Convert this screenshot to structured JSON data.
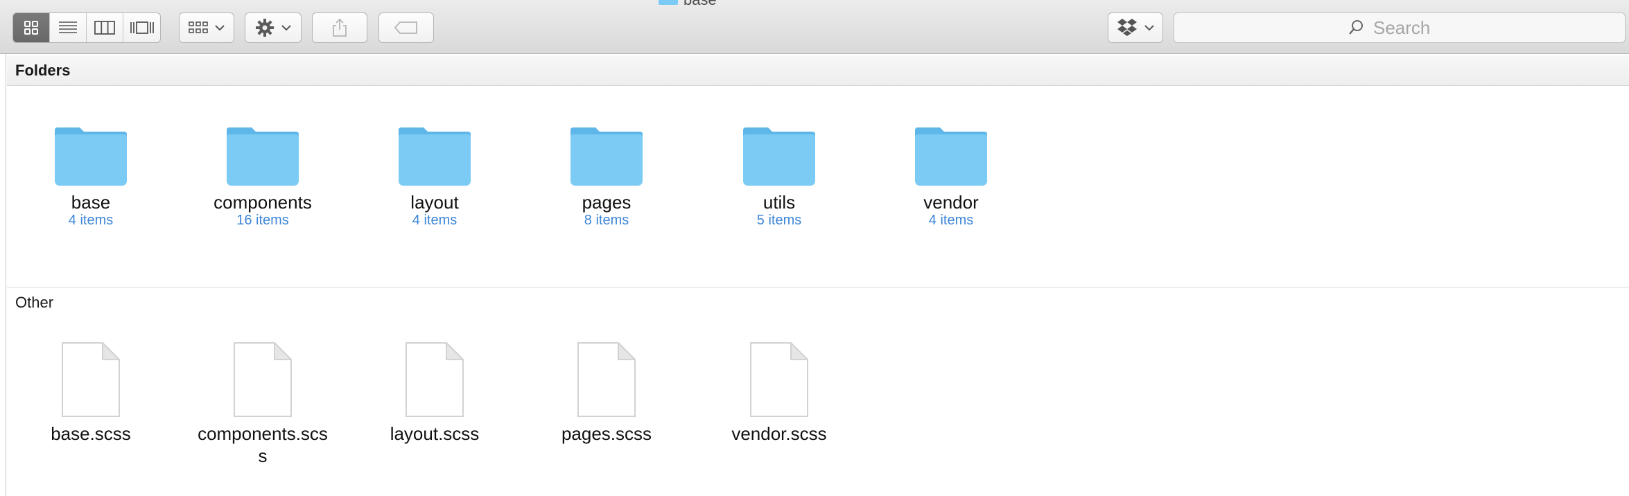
{
  "window": {
    "title": "base"
  },
  "toolbar": {
    "view_modes": [
      "icon-view",
      "list-view",
      "column-view",
      "cover-flow-view"
    ],
    "arrange_icon": "arrange-grid-icon",
    "action_icon": "gear-icon",
    "share_icon": "share-icon",
    "tag_icon": "tag-icon",
    "dropbox_icon": "dropbox-icon"
  },
  "search": {
    "placeholder": "Search"
  },
  "sections": {
    "folders": {
      "title": "Folders",
      "items": [
        {
          "name": "base",
          "count": "4 items"
        },
        {
          "name": "components",
          "count": "16 items"
        },
        {
          "name": "layout",
          "count": "4 items"
        },
        {
          "name": "pages",
          "count": "8 items"
        },
        {
          "name": "utils",
          "count": "5 items"
        },
        {
          "name": "vendor",
          "count": "4 items"
        }
      ]
    },
    "other": {
      "title": "Other",
      "items": [
        {
          "name": "base.scss"
        },
        {
          "name": "components.scss"
        },
        {
          "name": "layout.scss"
        },
        {
          "name": "pages.scss"
        },
        {
          "name": "vendor.scss"
        }
      ]
    }
  },
  "colors": {
    "folder": "#7ccbf5",
    "item_count": "#3d86d8",
    "selected_segment": "#6f6f6f"
  }
}
